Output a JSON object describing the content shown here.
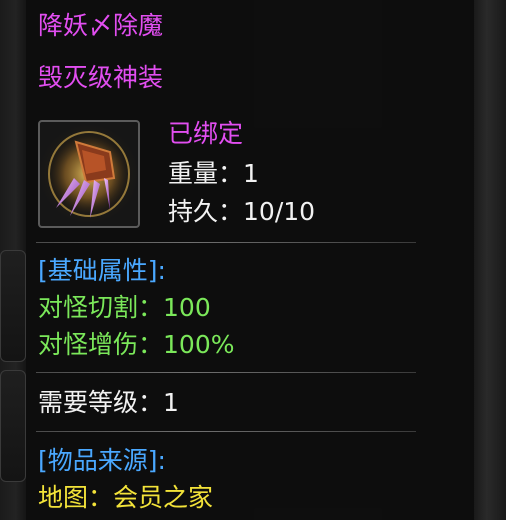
{
  "item": {
    "name": "降妖〆除魔",
    "category": "毁灭级神装",
    "bind_status": "已绑定",
    "weight_label": "重量：",
    "weight_value": "1",
    "durability_label": "持久：",
    "durability_value": "10/10",
    "icon": "claw-gauntlet-icon"
  },
  "base_attributes": {
    "header": "[基础属性]:",
    "stats": [
      {
        "label": "对怪切割：",
        "value": "100"
      },
      {
        "label": "对怪增伤：",
        "value": "100%"
      }
    ]
  },
  "requirement": {
    "label": "需要等级：",
    "value": "1"
  },
  "source": {
    "header": "[物品来源]:",
    "label": "地图：",
    "value": "会员之家"
  },
  "colors": {
    "name": "#e24ef1",
    "bind": "#e24ef1",
    "header": "#4aa8ff",
    "stat": "#7be85a",
    "source": "#f3e339",
    "text": "#f2f2f2"
  }
}
